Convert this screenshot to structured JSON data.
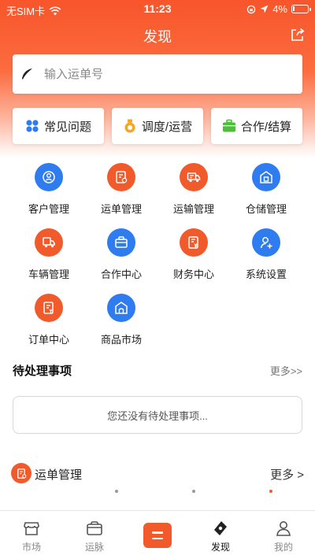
{
  "status": {
    "carrier": "无SIM卡",
    "time": "11:23",
    "battery": "4%"
  },
  "header": {
    "title": "发现"
  },
  "search": {
    "placeholder": "输入运单号"
  },
  "quick": [
    {
      "label": "常见问题",
      "icon": "grid-flower-icon",
      "color": "#2f7bf0"
    },
    {
      "label": "调度/运营",
      "icon": "medal-icon",
      "color": "#f5a623"
    },
    {
      "label": "合作/结算",
      "icon": "briefcase-icon",
      "color": "#4cbe3c"
    }
  ],
  "grid": [
    {
      "label": "客户管理",
      "icon": "customer-icon",
      "color": "blue"
    },
    {
      "label": "运单管理",
      "icon": "waybill-icon",
      "color": "orange"
    },
    {
      "label": "运输管理",
      "icon": "truck-icon",
      "color": "orange"
    },
    {
      "label": "仓储管理",
      "icon": "warehouse-icon",
      "color": "blue"
    },
    {
      "label": "车辆管理",
      "icon": "vehicle-icon",
      "color": "orange"
    },
    {
      "label": "合作中心",
      "icon": "briefcase-icon",
      "color": "blue"
    },
    {
      "label": "财务中心",
      "icon": "finance-icon",
      "color": "orange"
    },
    {
      "label": "系统设置",
      "icon": "user-add-icon",
      "color": "blue"
    },
    {
      "label": "订单中心",
      "icon": "order-icon",
      "color": "orange"
    },
    {
      "label": "商品市场",
      "icon": "shop-icon",
      "color": "blue"
    }
  ],
  "pending": {
    "title": "待处理事项",
    "more": "更多>>",
    "empty": "您还没有待处理事项..."
  },
  "waybill": {
    "title": "运单管理",
    "more": "更多 >"
  },
  "tabs": [
    {
      "label": "市场",
      "icon": "market-icon",
      "active": false
    },
    {
      "label": "运脉",
      "icon": "network-icon",
      "active": false
    },
    {
      "label": "",
      "icon": "menu-icon",
      "active": false
    },
    {
      "label": "发现",
      "icon": "discover-icon",
      "active": true
    },
    {
      "label": "我的",
      "icon": "profile-icon",
      "active": false
    }
  ],
  "colors": {
    "accent": "#f15a2b",
    "blue": "#2f7bf0"
  }
}
